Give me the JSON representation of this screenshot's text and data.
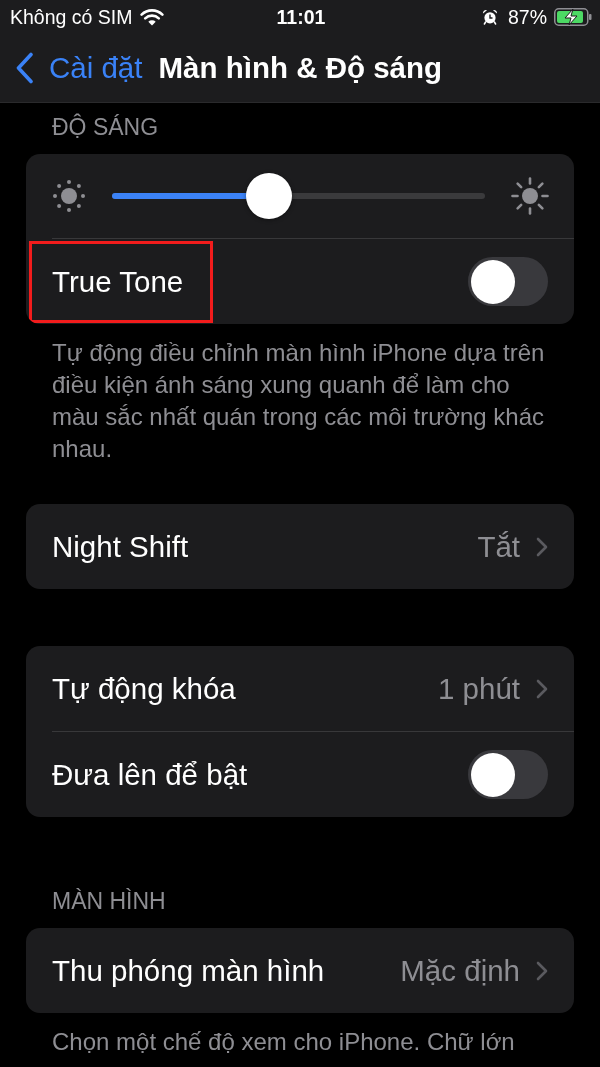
{
  "status_bar": {
    "carrier": "Không có SIM",
    "time": "11:01",
    "battery_percent": "87%",
    "charging": true
  },
  "nav": {
    "back_label": "Cài đặt",
    "title": "Màn hình & Độ sáng"
  },
  "sections": [
    {
      "header": "ĐỘ SÁNG",
      "rows": [
        {
          "kind": "slider",
          "level": 0.42,
          "highlighted": false
        },
        {
          "kind": "toggle",
          "label": "True Tone",
          "on": false,
          "highlighted": true
        }
      ],
      "footer": "Tự động điều chỉnh màn hình iPhone dựa trên điều kiện ánh sáng xung quanh để làm cho màu sắc nhất quán trong các môi trường khác nhau."
    },
    {
      "rows": [
        {
          "kind": "link",
          "label": "Night Shift",
          "value": "Tắt",
          "highlighted": false
        }
      ]
    },
    {
      "rows": [
        {
          "kind": "link",
          "label": "Tự động khóa",
          "value": "1 phút",
          "highlighted": false
        },
        {
          "kind": "toggle",
          "label": "Đưa lên để bật",
          "on": false,
          "highlighted": false
        }
      ]
    },
    {
      "header": "MÀN HÌNH",
      "rows": [
        {
          "kind": "link",
          "label": "Thu phóng màn hình",
          "value": "Mặc định",
          "highlighted": false
        }
      ],
      "footer": "Chọn một chế độ xem cho iPhone. Chữ lớn"
    }
  ]
}
